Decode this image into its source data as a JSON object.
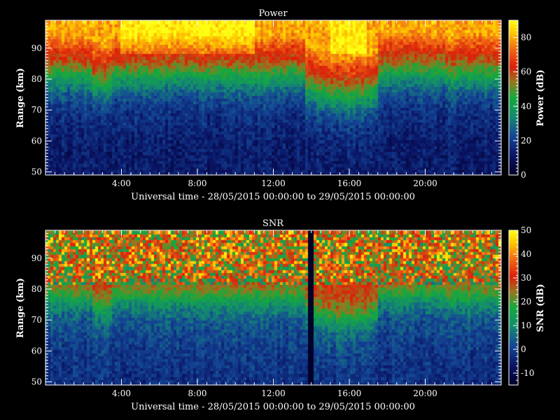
{
  "chart_data": [
    {
      "type": "heatmap",
      "title": "Power",
      "xlabel": "Universal time - 28/05/2015 00:00:00 to 29/05/2015 00:00:00",
      "ylabel": "Range (km)",
      "xlim": [
        0,
        24
      ],
      "ylim": [
        49,
        99
      ],
      "x_tick_labels": [
        "4:00",
        "8:00",
        "12:00",
        "16:00",
        "20:00"
      ],
      "x_tick_hours": [
        4,
        8,
        12,
        16,
        20
      ],
      "y_ticks": [
        50,
        60,
        70,
        80,
        90
      ],
      "colorbar": {
        "label": "Power (dB)",
        "range": [
          0,
          90
        ],
        "ticks": [
          0,
          20,
          40,
          60,
          80
        ]
      },
      "profile_summary_db": [
        {
          "range_km": 50,
          "value": 12
        },
        {
          "range_km": 60,
          "value": 13
        },
        {
          "range_km": 70,
          "value": 18
        },
        {
          "range_km": 75,
          "value": 25
        },
        {
          "range_km": 80,
          "value": 38
        },
        {
          "range_km": 85,
          "value": 55
        },
        {
          "range_km": 90,
          "value": 68
        },
        {
          "range_km": 95,
          "value": 80
        }
      ]
    },
    {
      "type": "heatmap",
      "title": "SNR",
      "xlabel": "Universal time - 28/05/2015 00:00:00 to 29/05/2015 00:00:00",
      "ylabel": "Range (km)",
      "xlim": [
        0,
        24
      ],
      "ylim": [
        49,
        99
      ],
      "x_tick_labels": [
        "4:00",
        "8:00",
        "12:00",
        "16:00",
        "20:00"
      ],
      "x_tick_hours": [
        4,
        8,
        12,
        16,
        20
      ],
      "y_ticks": [
        50,
        60,
        70,
        80,
        90
      ],
      "colorbar": {
        "label": "SNR (dB)",
        "range": [
          -15,
          50
        ],
        "ticks": [
          -10,
          0,
          10,
          20,
          30,
          40,
          50
        ]
      },
      "profile_summary_db": [
        {
          "range_km": 50,
          "value": -3
        },
        {
          "range_km": 60,
          "value": -1
        },
        {
          "range_km": 70,
          "value": 3
        },
        {
          "range_km": 75,
          "value": 10
        },
        {
          "range_km": 80,
          "value": 22
        },
        {
          "range_km": 85,
          "value": 28
        },
        {
          "range_km": 90,
          "value": 30
        },
        {
          "range_km": 95,
          "value": 30
        }
      ]
    }
  ]
}
